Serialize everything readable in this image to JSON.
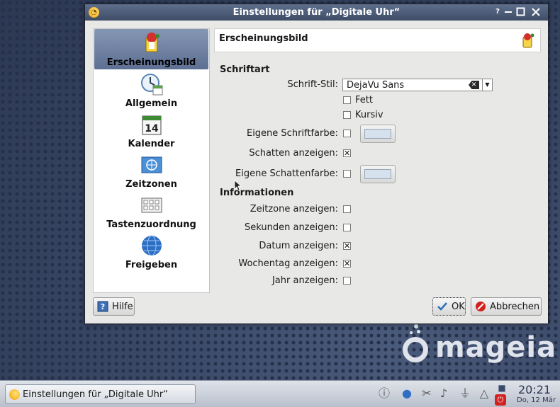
{
  "dialog": {
    "title": "Einstellungen für „Digitale Uhr“",
    "controls": {
      "help": "?",
      "minimize": "—",
      "maximize": "☐",
      "close": "✕"
    }
  },
  "sidebar": {
    "items": [
      {
        "label": "Erscheinungsbild",
        "icon": "appearance-icon",
        "selected": true
      },
      {
        "label": "Allgemein",
        "icon": "clock-calendar-icon"
      },
      {
        "label": "Kalender",
        "icon": "calendar-icon",
        "day": "14"
      },
      {
        "label": "Zeitzonen",
        "icon": "un-globe-icon"
      },
      {
        "label": "Tastenzuordnung",
        "icon": "keyboard-icon"
      },
      {
        "label": "Freigeben",
        "icon": "globe-icon"
      }
    ]
  },
  "page": {
    "header": "Erscheinungsbild",
    "font_section": "Schriftart",
    "font_style_label": "Schrift-Stil:",
    "font_style_value": "DejaVu Sans",
    "bold_label": "Fett",
    "italic_label": "Kursiv",
    "custom_font_color_label": "Eigene Schriftfarbe:",
    "show_shadow_label": "Schatten anzeigen:",
    "custom_shadow_color_label": "Eigene Schattenfarbe:",
    "info_section": "Informationen",
    "show_timezone_label": "Zeitzone anzeigen:",
    "show_seconds_label": "Sekunden anzeigen:",
    "show_date_label": "Datum anzeigen:",
    "show_weekday_label": "Wochentag anzeigen:",
    "show_year_label": "Jahr anzeigen:",
    "checks": {
      "bold": "",
      "italic": "",
      "custom_font_color": "",
      "show_shadow": "✕",
      "custom_shadow_color": "",
      "show_timezone": "",
      "show_seconds": "",
      "show_date": "✕",
      "show_weekday": "✕",
      "show_year": ""
    },
    "swatch_color": "#d6e1ee"
  },
  "buttons": {
    "help": "Hilfe",
    "ok": "OK",
    "cancel": "Abbrechen"
  },
  "desktop": {
    "logo_text": "mageia"
  },
  "taskbar": {
    "task_label": "Einstellungen für „Digitale Uhr“",
    "clock_time": "20:21",
    "clock_date": "Do, 12 Mär"
  }
}
